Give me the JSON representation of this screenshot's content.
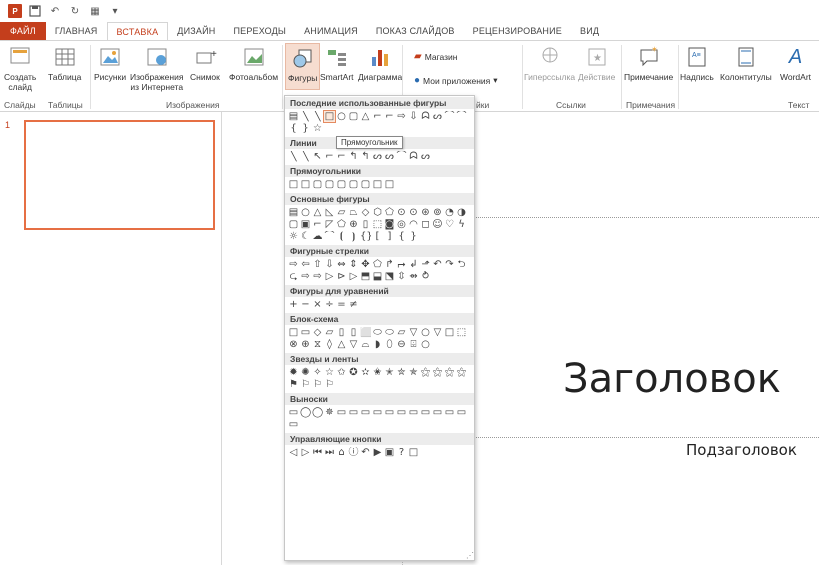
{
  "qat": {
    "icons": [
      "powerpoint-logo",
      "save-icon",
      "undo-icon",
      "redo-icon",
      "start-from-beginning-icon",
      "customize-qat-icon"
    ]
  },
  "tabs": [
    "ФАЙЛ",
    "ГЛАВНАЯ",
    "ВСТАВКА",
    "ДИЗАЙН",
    "ПЕРЕХОДЫ",
    "АНИМАЦИЯ",
    "ПОКАЗ СЛАЙДОВ",
    "РЕЦЕНЗИРОВАНИЕ",
    "ВИД"
  ],
  "ribbon": {
    "new_slide": "Создать\nслайд",
    "table": "Таблица",
    "pictures": "Рисунки",
    "online_pictures": "Изображения\nиз Интернета",
    "screenshot": "Снимок",
    "photo_album": "Фотоальбом",
    "shapes": "Фигуры",
    "smartart": "SmartArt",
    "chart": "Диаграмма",
    "store": "Магазин",
    "my_apps": "Мои приложения",
    "hyperlink": "Гиперссылка",
    "action": "Действие",
    "comment": "Примечание",
    "textbox": "Надпись",
    "header_footer": "Колонтитулы",
    "wordart": "WordArt",
    "groups": {
      "slides": "Слайды",
      "tables": "Таблицы",
      "images": "Изображения",
      "addins": "йки",
      "links": "Ссылки",
      "comments": "Примечания",
      "text": "Текст"
    }
  },
  "slide": {
    "thumb_number": "1",
    "title": "Заголовок",
    "subtitle": "Подзаголовок"
  },
  "dropdown": {
    "tooltip": "Прямоугольник",
    "categories": [
      {
        "label": "Последние использованные фигуры",
        "shapes": [
          "▤",
          "╲",
          "╲",
          "□",
          "○",
          "▢",
          "△",
          "⌐",
          "⌐",
          "⇨",
          "⇩",
          "ᗣ",
          "ᔕ",
          "⌒",
          "⌒",
          "{",
          "}",
          "☆"
        ],
        "selected": 3
      },
      {
        "label": "Линии",
        "shapes": [
          "╲",
          "╲",
          "↖",
          "⌐",
          "⌐",
          "↰",
          "↰",
          "ᔕ",
          "ᔕ",
          "⌒",
          "ᗣ",
          "ᔕ"
        ]
      },
      {
        "label": "Прямоугольники",
        "shapes": [
          "□",
          "□",
          "▢",
          "▢",
          "▢",
          "▢",
          "▢",
          "□",
          "□"
        ]
      },
      {
        "label": "Основные фигуры",
        "shapes": [
          "▤",
          "○",
          "△",
          "◺",
          "▱",
          "⏢",
          "◇",
          "⬡",
          "⬠",
          "⊙",
          "⊙",
          "⊛",
          "⊚",
          "◔",
          "◑",
          "▢",
          "▣",
          "⌐",
          "◸",
          "⬠",
          "⊕",
          "▯",
          "⬚",
          "◙",
          "◎",
          "◠",
          "◻",
          "☺",
          "♡",
          "ϟ",
          "☼",
          "☾",
          "☁",
          "⌒",
          "⦗",
          "⦘",
          "{}",
          "[",
          "]",
          "{",
          "}"
        ]
      },
      {
        "label": "Фигурные стрелки",
        "shapes": [
          "⇨",
          "⇦",
          "⇧",
          "⇩",
          "⇔",
          "⇕",
          "✥",
          "⬠",
          "↱",
          "⮣",
          "↲",
          "⬏",
          "↶",
          "↷",
          "⮌",
          "⮎",
          "⇨",
          "⇨",
          "▷",
          "⊳",
          "▷",
          "⬒",
          "⬓",
          "⬔",
          "⇳",
          "⇴",
          "⥁"
        ]
      },
      {
        "label": "Фигуры для уравнений",
        "shapes": [
          "+",
          "−",
          "×",
          "÷",
          "=",
          "≠"
        ]
      },
      {
        "label": "Блок-схема",
        "shapes": [
          "□",
          "▭",
          "◇",
          "▱",
          "▯",
          "▯",
          "⬜",
          "⬭",
          "⬭",
          "⏥",
          "▽",
          "○",
          "▽",
          "□",
          "⬚",
          "⊗",
          "⊕",
          "⧖",
          "◊",
          "△",
          "▽",
          "⌓",
          "◗",
          "⬯",
          "⊖",
          "⌹",
          "○"
        ]
      },
      {
        "label": "Звезды и ленты",
        "shapes": [
          "✹",
          "✺",
          "✧",
          "☆",
          "✩",
          "✪",
          "✫",
          "✬",
          "✭",
          "✮",
          "✯",
          "⚝",
          "⚝",
          "⚝",
          "⚝",
          "⚑",
          "⚐",
          "⚐",
          "⚐"
        ]
      },
      {
        "label": "Выноски",
        "shapes": [
          "▭",
          "◯",
          "◯",
          "✵",
          "▭",
          "▭",
          "▭",
          "▭",
          "▭",
          "▭",
          "▭",
          "▭",
          "▭",
          "▭",
          "▭",
          "▭"
        ]
      },
      {
        "label": "Управляющие кнопки",
        "shapes": [
          "◁",
          "▷",
          "⏮",
          "⏭",
          "⌂",
          "ⓘ",
          "↶",
          "▶",
          "▣",
          "?",
          "□"
        ]
      }
    ]
  }
}
